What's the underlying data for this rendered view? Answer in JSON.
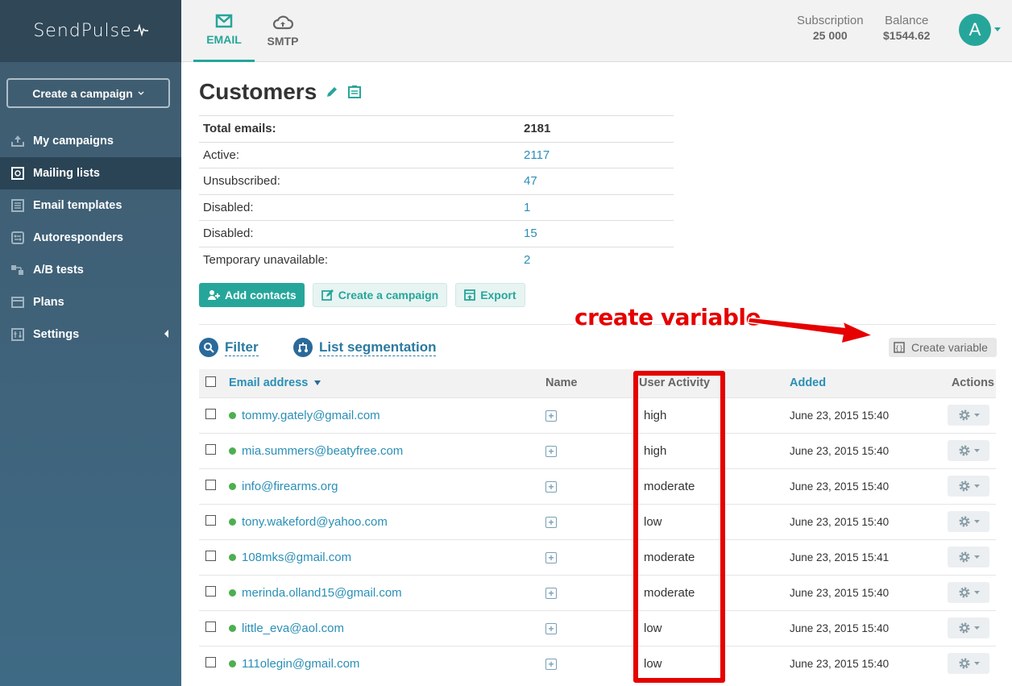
{
  "app": {
    "logo": "SendPulse"
  },
  "sidebar": {
    "create_label": "Create a campaign",
    "items": [
      {
        "label": "My campaigns",
        "icon": "upload-icon"
      },
      {
        "label": "Mailing lists",
        "icon": "list-book-icon"
      },
      {
        "label": "Email templates",
        "icon": "template-icon"
      },
      {
        "label": "Autoresponders",
        "icon": "autoresponder-icon"
      },
      {
        "label": "A/B tests",
        "icon": "ab-test-icon"
      },
      {
        "label": "Plans",
        "icon": "wallet-icon"
      },
      {
        "label": "Settings",
        "icon": "sliders-icon"
      }
    ]
  },
  "topbar": {
    "tabs": [
      {
        "label": "EMAIL",
        "icon": "envelope-icon"
      },
      {
        "label": "SMTP",
        "icon": "cloud-upload-icon"
      }
    ],
    "subscription_label": "Subscription",
    "subscription_value": "25 000",
    "balance_label": "Balance",
    "balance_value": "$1544.62",
    "avatar_letter": "A"
  },
  "page": {
    "title": "Customers",
    "stats": [
      {
        "label": "Total emails:",
        "value": "2181"
      },
      {
        "label": "Active:",
        "value": "2117"
      },
      {
        "label": "Unsubscribed:",
        "value": "47"
      },
      {
        "label": "Disabled:",
        "value": "1"
      },
      {
        "label": "Disabled:",
        "value": "15"
      },
      {
        "label": "Temporary unavailable:",
        "value": "2"
      }
    ],
    "buttons": {
      "add_contacts": "Add contacts",
      "create_campaign": "Create a campaign",
      "export": "Export"
    },
    "filter_label": "Filter",
    "segmentation_label": "List segmentation",
    "annotation": "create variable",
    "create_variable": "Create variable"
  },
  "table": {
    "headers": {
      "email": "Email address",
      "name": "Name",
      "activity": "User Activity",
      "added": "Added",
      "actions": "Actions"
    },
    "rows": [
      {
        "email": "tommy.gately@gmail.com",
        "activity": "high",
        "added": "June 23, 2015 15:40"
      },
      {
        "email": "mia.summers@beatyfree.com",
        "activity": "high",
        "added": "June 23, 2015 15:40"
      },
      {
        "email": "info@firearms.org",
        "activity": "moderate",
        "added": "June 23, 2015 15:40"
      },
      {
        "email": "tony.wakeford@yahoo.com",
        "activity": "low",
        "added": "June 23, 2015 15:40"
      },
      {
        "email": "108mks@gmail.com",
        "activity": "moderate",
        "added": "June 23, 2015 15:41"
      },
      {
        "email": "merinda.olland15@gmail.com",
        "activity": "moderate",
        "added": "June 23, 2015 15:40"
      },
      {
        "email": "little_eva@aol.com",
        "activity": "low",
        "added": "June 23, 2015 15:40"
      },
      {
        "email": "111olegin@gmail.com",
        "activity": "low",
        "added": "June 23, 2015 15:40"
      }
    ]
  },
  "colors": {
    "accent": "#26a69a",
    "link": "#2a8fb7",
    "sidebar": "#3f5b6e",
    "annotation": "#e60000"
  }
}
